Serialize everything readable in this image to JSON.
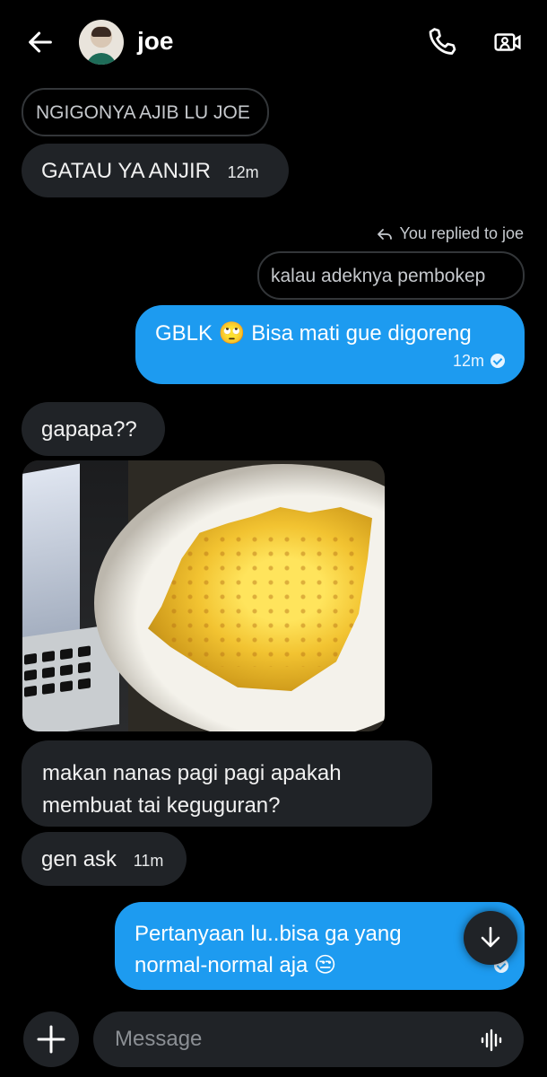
{
  "header": {
    "back_icon": "arrow-left-icon",
    "contact_name": "joe",
    "call_icon": "phone-icon",
    "video_icon": "video-call-icon"
  },
  "messages": [
    {
      "side": "incoming",
      "type": "quoted",
      "text": "NGIGONYA AJIB LU JOE"
    },
    {
      "side": "incoming",
      "type": "text",
      "text": "GATAU YA ANJIR",
      "time": "12m"
    },
    {
      "side": "outgoing",
      "type": "reply-note",
      "text": "You replied to joe"
    },
    {
      "side": "outgoing",
      "type": "quoted",
      "text": "kalau adeknya pembokep"
    },
    {
      "side": "outgoing",
      "type": "text",
      "text_before_emoji": "GBLK",
      "emoji": "🙄",
      "text_after_emoji": "Bisa mati gue digoreng",
      "time": "12m"
    },
    {
      "side": "incoming",
      "type": "text",
      "text": "gapapa??"
    },
    {
      "side": "incoming",
      "type": "image",
      "image_icon": "pineapple-photo"
    },
    {
      "side": "incoming",
      "type": "text",
      "line1": "makan nanas pagi pagi apakah",
      "line2": "membuat tai keguguran?"
    },
    {
      "side": "incoming",
      "type": "text",
      "text": "gen ask",
      "time": "11m"
    },
    {
      "side": "outgoing",
      "type": "text",
      "line1": "Pertanyaan lu..bisa ga yang",
      "line2_before_emoji": "normal-normal aja",
      "emoji": "😒"
    }
  ],
  "scroll_button_icon": "chevron-down-icon",
  "composer": {
    "add_icon": "plus-icon",
    "placeholder": "Message",
    "voice_icon": "voice-wave-icon"
  },
  "colors": {
    "background": "#000000",
    "incoming_bubble": "#202327",
    "outgoing_bubble": "#1d9bf0",
    "text": "#e7e9ea"
  }
}
